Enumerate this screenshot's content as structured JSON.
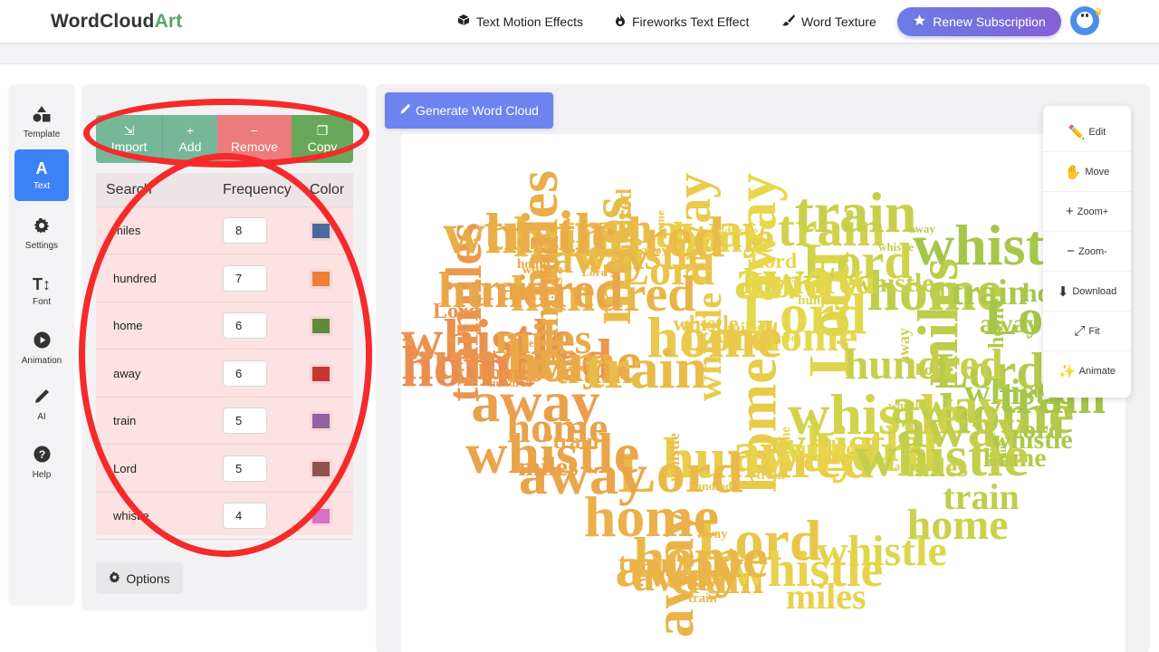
{
  "brand": {
    "name_part1": "WordCloud",
    "name_part2": "Art"
  },
  "nav": {
    "links": [
      {
        "label": "Text Motion Effects",
        "icon": "cube-icon"
      },
      {
        "label": "Fireworks Text Effect",
        "icon": "flame-icon"
      },
      {
        "label": "Word Texture",
        "icon": "brush-icon"
      }
    ],
    "renew_label": "Renew Subscription"
  },
  "sidebar": {
    "items": [
      {
        "label": "Template",
        "icon": "shapes-icon",
        "active": false
      },
      {
        "label": "Text",
        "icon": "text-a-icon",
        "active": true
      },
      {
        "label": "Settings",
        "icon": "gear-icon",
        "active": false
      },
      {
        "label": "Font",
        "icon": "font-size-icon",
        "active": false
      },
      {
        "label": "Animation",
        "icon": "play-icon",
        "active": false
      },
      {
        "label": "AI",
        "icon": "pen-icon",
        "active": false
      },
      {
        "label": "Help",
        "icon": "question-icon",
        "active": false
      }
    ]
  },
  "word_panel": {
    "buttons": {
      "import": "Import",
      "add": "Add",
      "remove": "Remove",
      "copy": "Copy"
    },
    "headers": {
      "search": "Search",
      "frequency": "Frequency",
      "color": "Color"
    },
    "rows": [
      {
        "word": "miles",
        "frequency": "8",
        "color": "#4a6a9e"
      },
      {
        "word": "hundred",
        "frequency": "7",
        "color": "#ee7d36"
      },
      {
        "word": "home",
        "frequency": "6",
        "color": "#5e8a3e"
      },
      {
        "word": "away",
        "frequency": "6",
        "color": "#c83632"
      },
      {
        "word": "train",
        "frequency": "5",
        "color": "#9460a2"
      },
      {
        "word": "Lord",
        "frequency": "5",
        "color": "#8e534a"
      },
      {
        "word": "whistle",
        "frequency": "4",
        "color": "#d771c4"
      }
    ],
    "options_label": "Options"
  },
  "canvas": {
    "generate_label": "Generate Word Cloud",
    "shape": "heart",
    "gradient_colors": [
      "#e8705a",
      "#eaa848",
      "#e8d94c",
      "#a6c64a"
    ]
  },
  "tools": {
    "items": [
      {
        "label": "Edit",
        "icon": "pencil-icon"
      },
      {
        "label": "Move",
        "icon": "hand-icon"
      },
      {
        "label": "Zoom+",
        "icon": "plus-icon"
      },
      {
        "label": "Zoom-",
        "icon": "minus-icon"
      },
      {
        "label": "Download",
        "icon": "download-icon"
      },
      {
        "label": "Fit",
        "icon": "fit-icon"
      },
      {
        "label": "Animate",
        "icon": "sparkle-icon"
      }
    ]
  }
}
